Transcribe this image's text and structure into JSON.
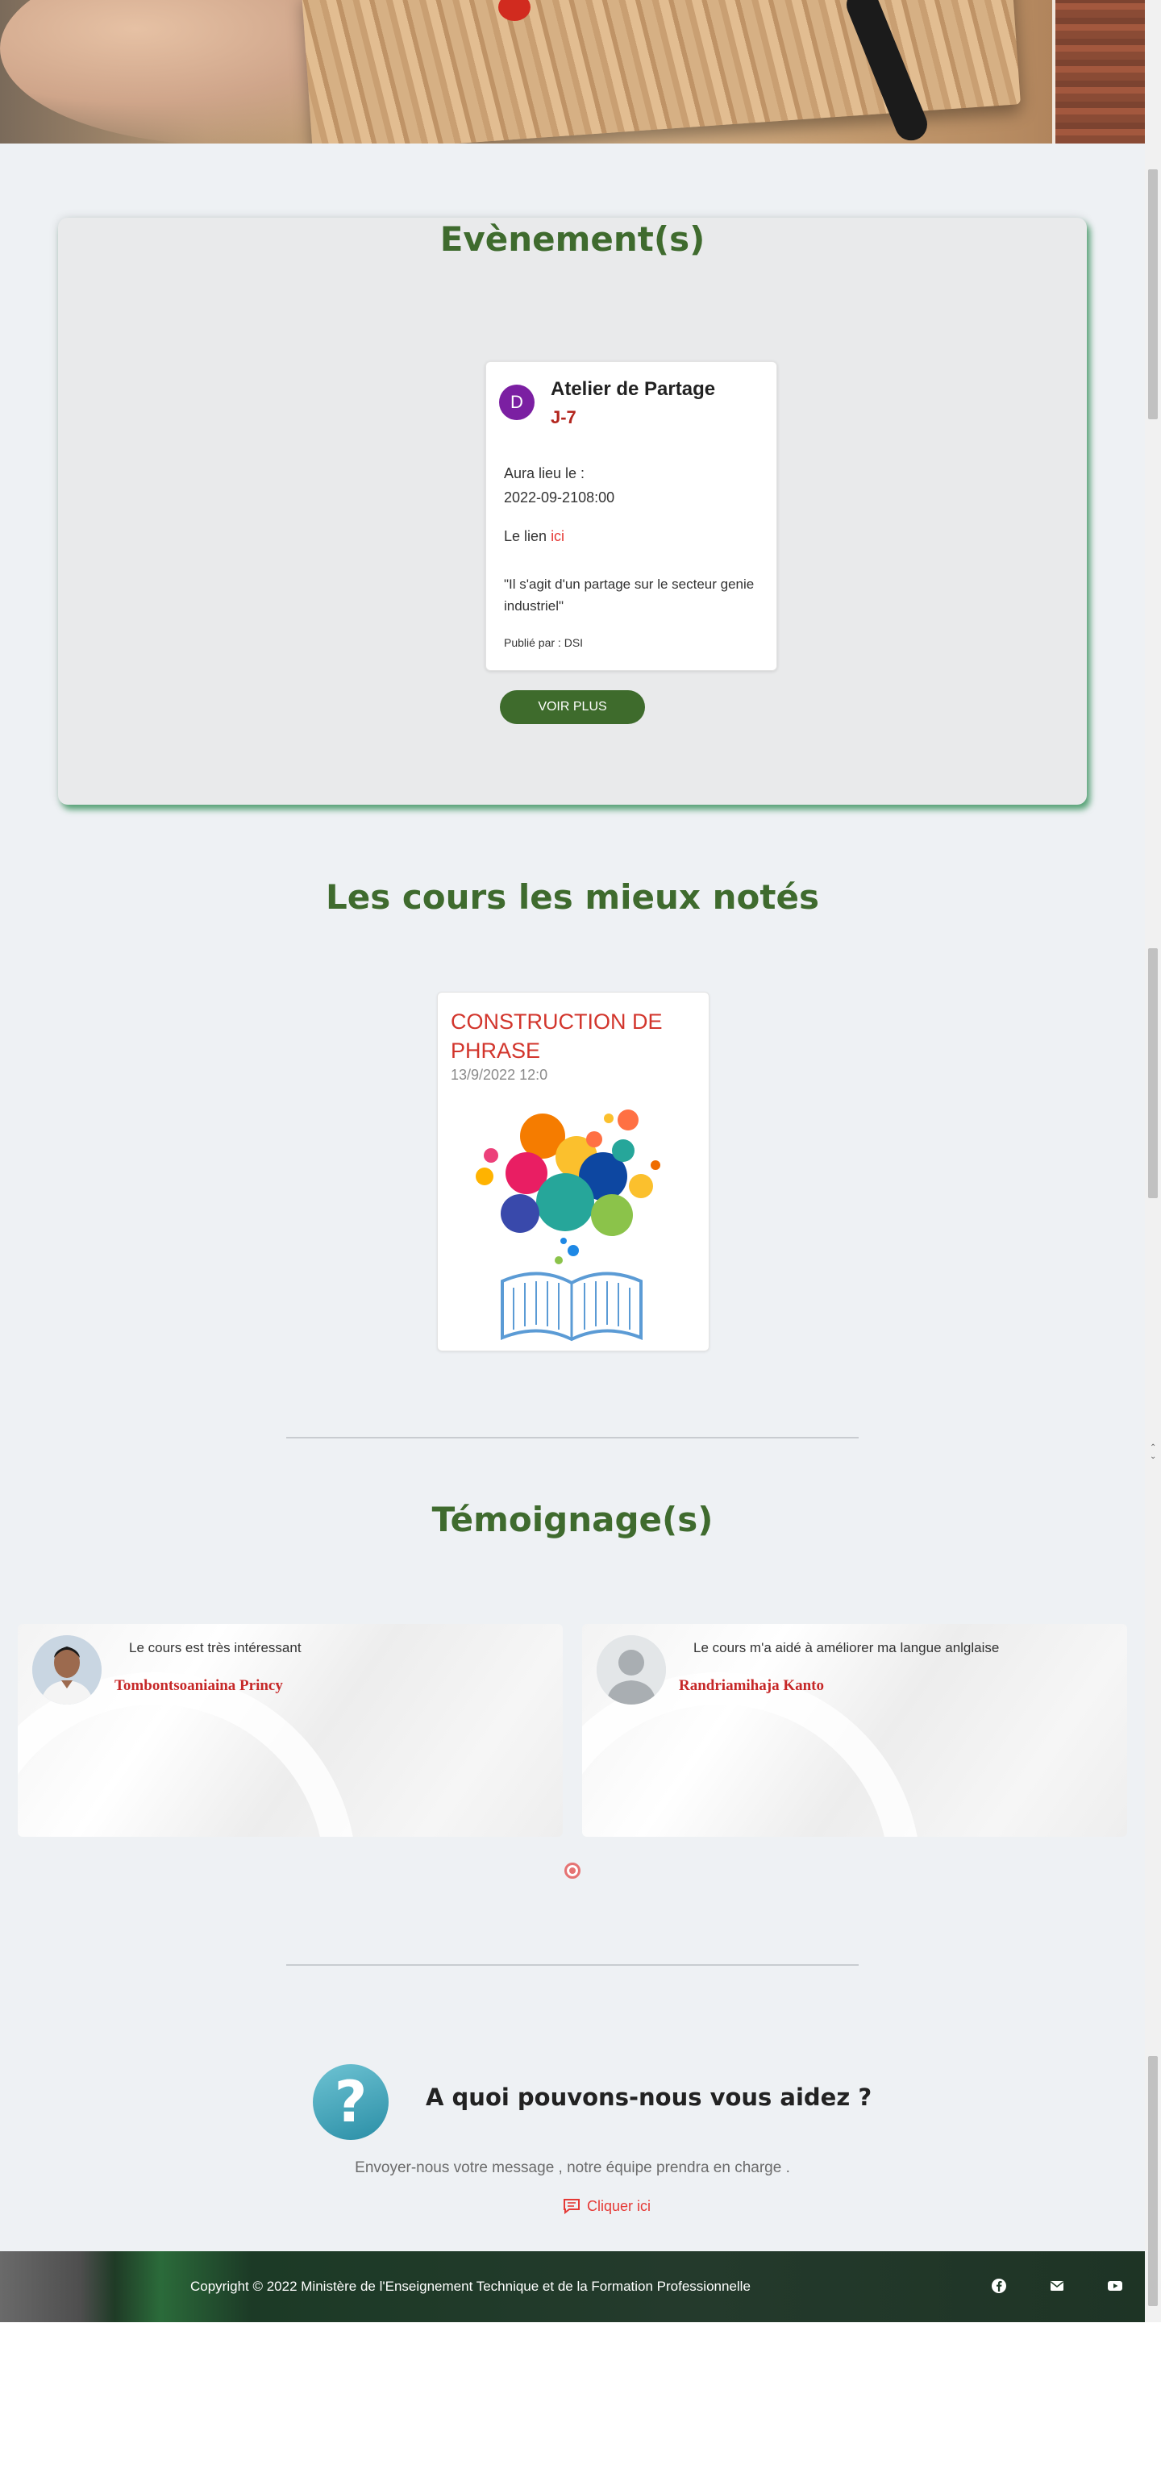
{
  "events": {
    "section_title": "Evènement(s)",
    "card": {
      "avatar_letter": "D",
      "title": "Atelier de Partage",
      "countdown": "J-7",
      "when_label": "Aura lieu le :",
      "when_value": "2022-09-2108:00",
      "link_label": "Le lien",
      "link_text": "ici",
      "description": "\"Il s'agit d'un partage sur le secteur genie industriel\"",
      "author": "Publié par : DSI"
    },
    "more_button": "VOIR PLUS"
  },
  "courses": {
    "section_title": "Les cours les mieux notés",
    "items": [
      {
        "title": "CONSTRUCTION DE PHRASE",
        "date": "13/9/2022 12:0"
      }
    ]
  },
  "testimonials": {
    "section_title": "Témoignage(s)",
    "items": [
      {
        "quote": "Le cours est très intéressant",
        "name": "Tombontsoaniaina Princy",
        "photo": "person-photo"
      },
      {
        "quote": "Le cours m'a aidé à améliorer ma langue anlglaise",
        "name": "Randriamihaja Kanto",
        "photo": "default-avatar"
      }
    ]
  },
  "help": {
    "title": "A quoi pouvons-nous vous aidez ?",
    "text": "Envoyer-nous votre message , notre équipe prendra en charge .",
    "link": "Cliquer ici"
  },
  "footer": {
    "copyright": "Copyright © 2022 Ministère de l'Enseignement Technique et de la Formation Professionnelle",
    "social": [
      "facebook-icon",
      "mail-icon",
      "youtube-icon"
    ]
  },
  "colors": {
    "brand_green": "#3f6b2e",
    "accent_red": "#d2352c",
    "background": "#eef1f4"
  }
}
